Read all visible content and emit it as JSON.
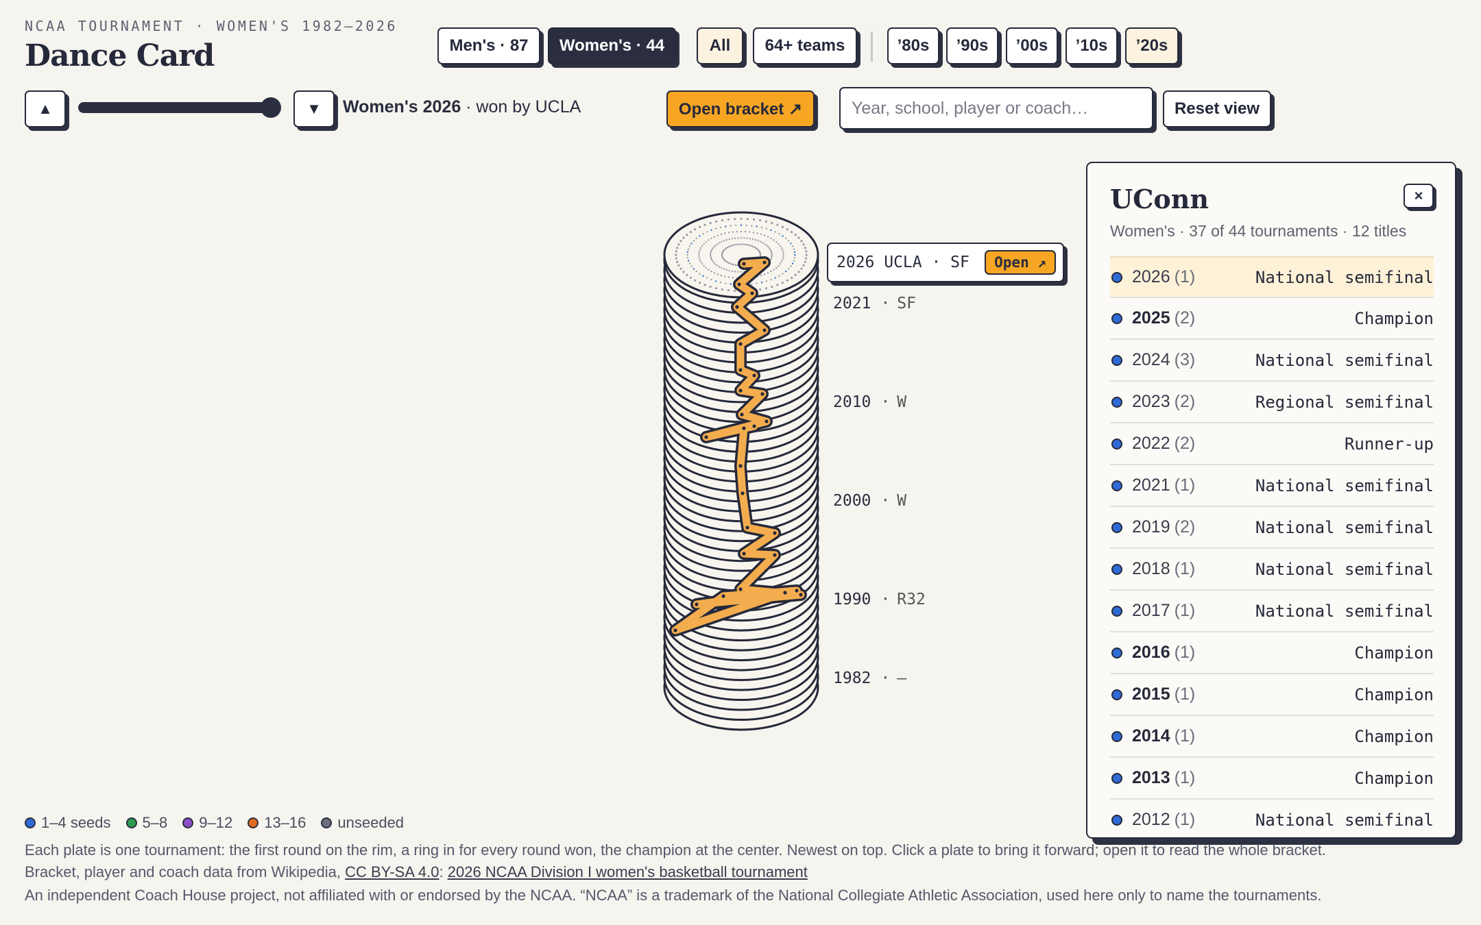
{
  "header": {
    "overline": "NCAA TOURNAMENT · WOMEN'S 1982–2026",
    "title": "Dance Card"
  },
  "tabs": {
    "mens": "Men's · 87",
    "womens": "Women's · 44"
  },
  "filters": {
    "all": "All",
    "teams64": "64+ teams",
    "decades": [
      "’80s",
      "’90s",
      "’00s",
      "’10s",
      "’20s"
    ]
  },
  "nav": {
    "up_icon": "triangle-up-icon",
    "down_icon": "triangle-down-icon",
    "up_glyph": "▲",
    "down_glyph": "▼",
    "slider_level": 1.0,
    "status_strong": "Women's 2026",
    "status_rest": " · won by UCLA",
    "open_bracket": "Open bracket ↗",
    "search_placeholder": "Year, school, player or coach…",
    "reset": "Reset view"
  },
  "stack": {
    "callout": {
      "text": "2026 UCLA · SF",
      "open": "Open ↗"
    },
    "labels": [
      {
        "year": "2021",
        "sep": "·",
        "result": "SF"
      },
      {
        "year": "2010",
        "sep": "·",
        "result": "W"
      },
      {
        "year": "2000",
        "sep": "·",
        "result": "W"
      },
      {
        "year": "1990",
        "sep": "·",
        "result": "R32"
      },
      {
        "year": "1982",
        "sep": "·",
        "result": "—"
      }
    ]
  },
  "panel": {
    "title": "UConn",
    "subtitle": "Women's · 37 of 44 tournaments · 12 titles",
    "close": "×",
    "rows": [
      {
        "year": "2026",
        "seed": "(1)",
        "result": "National semifinal",
        "title": false
      },
      {
        "year": "2025",
        "seed": "(2)",
        "result": "Champion",
        "title": true
      },
      {
        "year": "2024",
        "seed": "(3)",
        "result": "National semifinal",
        "title": false
      },
      {
        "year": "2023",
        "seed": "(2)",
        "result": "Regional semifinal",
        "title": false
      },
      {
        "year": "2022",
        "seed": "(2)",
        "result": "Runner-up",
        "title": false
      },
      {
        "year": "2021",
        "seed": "(1)",
        "result": "National semifinal",
        "title": false
      },
      {
        "year": "2019",
        "seed": "(2)",
        "result": "National semifinal",
        "title": false
      },
      {
        "year": "2018",
        "seed": "(1)",
        "result": "National semifinal",
        "title": false
      },
      {
        "year": "2017",
        "seed": "(1)",
        "result": "National semifinal",
        "title": false
      },
      {
        "year": "2016",
        "seed": "(1)",
        "result": "Champion",
        "title": true
      },
      {
        "year": "2015",
        "seed": "(1)",
        "result": "Champion",
        "title": true
      },
      {
        "year": "2014",
        "seed": "(1)",
        "result": "Champion",
        "title": true
      },
      {
        "year": "2013",
        "seed": "(1)",
        "result": "Champion",
        "title": true
      },
      {
        "year": "2012",
        "seed": "(1)",
        "result": "National semifinal",
        "title": false
      }
    ]
  },
  "legend": [
    {
      "label": "1–4 seeds",
      "color": "#2f6bd6"
    },
    {
      "label": "5–8",
      "color": "#2e9a4f"
    },
    {
      "label": "9–12",
      "color": "#8a4fc8"
    },
    {
      "label": "13–16",
      "color": "#e06a1f"
    },
    {
      "label": "unseeded",
      "color": "#6b6e7a"
    }
  ],
  "footer": {
    "line1": "Each plate is one tournament: the first round on the rim, a ring in for every round won, the champion at the center. Newest on top. Click a plate to bring it forward; open it to read the whole bracket.",
    "line2_prefix": "Bracket, player and coach data from Wikipedia, ",
    "license": "CC BY-SA 4.0",
    "line2_mid": ": ",
    "source": "2026 NCAA Division I women's basketball tournament",
    "line3": "An independent Coach House project, not affiliated with or endorsed by the NCAA. “NCAA” is a trademark of the National Collegiate Athletic Association, used here only to name the tournaments."
  },
  "colors": {
    "ink": "#26293a",
    "accent": "#f6a623",
    "highlight_row": "#fdf2d8",
    "background": "#f5f4ef"
  }
}
